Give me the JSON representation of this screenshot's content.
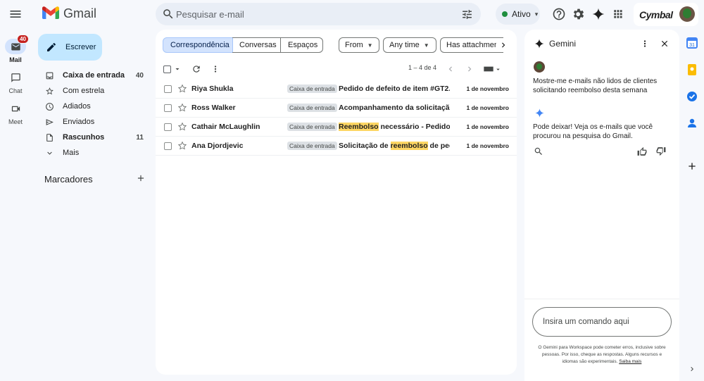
{
  "app": {
    "brand": "Gmail"
  },
  "search": {
    "placeholder": "Pesquisar e-mail"
  },
  "status": {
    "label": "Ativo",
    "color": "#1e8e3e"
  },
  "account": {
    "org_name": "Cymbal"
  },
  "rail": [
    {
      "label": "Mail",
      "badge": "40"
    },
    {
      "label": "Chat"
    },
    {
      "label": "Meet"
    }
  ],
  "compose_label": "Escrever",
  "nav": [
    {
      "label": "Caixa de entrada",
      "count": "40"
    },
    {
      "label": "Com estrela",
      "count": ""
    },
    {
      "label": "Adiados",
      "count": ""
    },
    {
      "label": "Enviados",
      "count": ""
    },
    {
      "label": "Rascunhos",
      "count": "11"
    },
    {
      "label": "Mais",
      "count": ""
    }
  ],
  "labels_title": "Marcadores",
  "tabs": [
    "Correspondência",
    "Conversas",
    "Espaços"
  ],
  "filters": [
    "From",
    "Any time",
    "Has attachment"
  ],
  "pagination": "1 – 4 de 4",
  "emails": [
    {
      "sender": "Riya Shukla",
      "tag": "Caixa de entrada",
      "subject_parts": [
        "Pedido de defeito de item #GT2..."
      ],
      "date": "1 de novembro"
    },
    {
      "sender": "Ross Walker",
      "tag": "Caixa de entrada",
      "subject_parts": [
        "Acompanhamento da solicitaçã..."
      ],
      "date": "1 de novembro"
    },
    {
      "sender": "Cathair McLaughlin",
      "tag": "Caixa de entrada",
      "subject_pre": "",
      "subject_mark": "Reembolso",
      "subject_post": " necessário - Pedido ...",
      "date": "1 de novembro"
    },
    {
      "sender": "Ana Djordjevic",
      "tag": "Caixa de entrada",
      "subject_pre": "Solicitação de ",
      "subject_mark": "reembolso",
      "subject_post": " de ped...",
      "date": "1 de novembro"
    }
  ],
  "gemini": {
    "title": "Gemini",
    "user_message": "Mostre-me e-mails não lidos de clientes solicitando reembolso desta semana",
    "bot_message": "Pode deixar! Veja os e-mails que você procurou na pesquisa do Gmail.",
    "input_placeholder": "Insira um comando aqui",
    "disclaimer": "O Gemini para Workspace pode cometer erros, inclusive sobre pessoas. Por isso, cheque as respostas. Alguns recursos e idiomas são experimentais.",
    "learn_more": "Saiba mais"
  }
}
